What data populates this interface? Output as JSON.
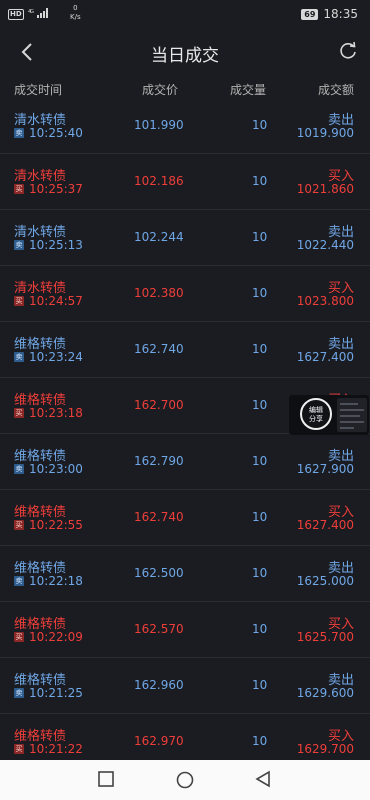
{
  "status_bar": {
    "hd": "HD",
    "network": "4G",
    "speed_value": "0",
    "speed_unit": "K/s",
    "battery": "69",
    "time": "18:35"
  },
  "header": {
    "title": "当日成交",
    "back_icon": "chevron-left-icon",
    "refresh_icon": "refresh-icon"
  },
  "columns": {
    "time": "成交时间",
    "price": "成交价",
    "qty": "成交量",
    "amount": "成交额"
  },
  "trades": [
    {
      "name": "清水转债",
      "tag": "卖",
      "time": "10:25:40",
      "price": "101.990",
      "qty": "10",
      "side": "卖出",
      "amount": "1019.900",
      "type": "sell"
    },
    {
      "name": "清水转债",
      "tag": "买",
      "time": "10:25:37",
      "price": "102.186",
      "qty": "10",
      "side": "买入",
      "amount": "1021.860",
      "type": "buy"
    },
    {
      "name": "清水转债",
      "tag": "卖",
      "time": "10:25:13",
      "price": "102.244",
      "qty": "10",
      "side": "卖出",
      "amount": "1022.440",
      "type": "sell"
    },
    {
      "name": "清水转债",
      "tag": "买",
      "time": "10:24:57",
      "price": "102.380",
      "qty": "10",
      "side": "买入",
      "amount": "1023.800",
      "type": "buy"
    },
    {
      "name": "维格转债",
      "tag": "卖",
      "time": "10:23:24",
      "price": "162.740",
      "qty": "10",
      "side": "卖出",
      "amount": "1627.400",
      "type": "sell"
    },
    {
      "name": "维格转债",
      "tag": "买",
      "time": "10:23:18",
      "price": "162.700",
      "qty": "10",
      "side": "买入",
      "amount": "",
      "type": "buy"
    },
    {
      "name": "维格转债",
      "tag": "卖",
      "time": "10:23:00",
      "price": "162.790",
      "qty": "10",
      "side": "卖出",
      "amount": "1627.900",
      "type": "sell"
    },
    {
      "name": "维格转债",
      "tag": "买",
      "time": "10:22:55",
      "price": "162.740",
      "qty": "10",
      "side": "买入",
      "amount": "1627.400",
      "type": "buy"
    },
    {
      "name": "维格转债",
      "tag": "卖",
      "time": "10:22:18",
      "price": "162.500",
      "qty": "10",
      "side": "卖出",
      "amount": "1625.000",
      "type": "sell"
    },
    {
      "name": "维格转债",
      "tag": "买",
      "time": "10:22:09",
      "price": "162.570",
      "qty": "10",
      "side": "买入",
      "amount": "1625.700",
      "type": "buy"
    },
    {
      "name": "维格转债",
      "tag": "卖",
      "time": "10:21:25",
      "price": "162.960",
      "qty": "10",
      "side": "卖出",
      "amount": "1629.600",
      "type": "sell"
    },
    {
      "name": "维格转债",
      "tag": "买",
      "time": "10:21:22",
      "price": "162.970",
      "qty": "10",
      "side": "买入",
      "amount": "1629.700",
      "type": "buy"
    }
  ],
  "share_widget": {
    "line1": "编辑",
    "line2": "分享"
  },
  "nav_bar": {
    "recent_icon": "square-icon",
    "home_icon": "circle-icon",
    "back_icon": "triangle-back-icon"
  }
}
